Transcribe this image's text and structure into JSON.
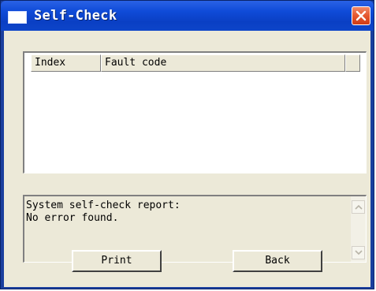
{
  "window": {
    "title": "Self-Check",
    "icon": "window-icon",
    "close_icon": "close-icon"
  },
  "fault_list": {
    "columns": [
      "Index",
      "Fault code",
      ""
    ],
    "rows": []
  },
  "report": {
    "lines": [
      "System self-check report:",
      "No error found."
    ],
    "scroll_up_icon": "chevron-up-icon",
    "scroll_down_icon": "chevron-down-icon"
  },
  "buttons": {
    "print_label": "Print",
    "back_label": "Back"
  },
  "colors": {
    "titlebar": "#0a3fc4",
    "client_bg": "#ece9d8",
    "close_button": "#e5572f"
  }
}
